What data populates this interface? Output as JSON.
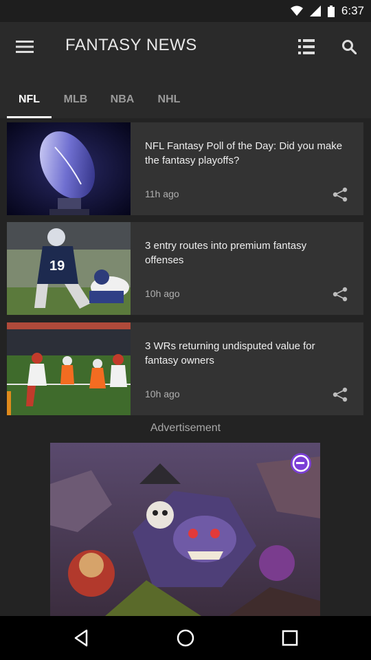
{
  "status": {
    "time": "6:37"
  },
  "header": {
    "title": "FANTASY NEWS",
    "icons": {
      "menu": "hamburger-menu-icon",
      "list": "list-view-icon",
      "search": "search-icon"
    }
  },
  "tabs": [
    {
      "label": "NFL",
      "active": true
    },
    {
      "label": "MLB",
      "active": false
    },
    {
      "label": "NBA",
      "active": false
    },
    {
      "label": "NHL",
      "active": false
    }
  ],
  "articles": [
    {
      "headline": "NFL Fantasy Poll of the Day: Did you make the fantasy playoffs?",
      "time": "11h ago",
      "image": "football-trophy-photo"
    },
    {
      "headline": "3 entry routes into premium fantasy offenses",
      "time": "10h ago",
      "image": "football-game-photo"
    },
    {
      "headline": "3 WRs returning undisputed value for fantasy owners",
      "time": "10h ago",
      "image": "football-celebration-photo"
    }
  ],
  "advertisement": {
    "label": "Advertisement",
    "image": "fantasy-game-creatures-ad"
  },
  "colors": {
    "background": "#232323",
    "appbar": "#2a2a2a",
    "card": "#333333",
    "text_primary": "#ffffff",
    "text_muted": "#9a9a9a"
  }
}
